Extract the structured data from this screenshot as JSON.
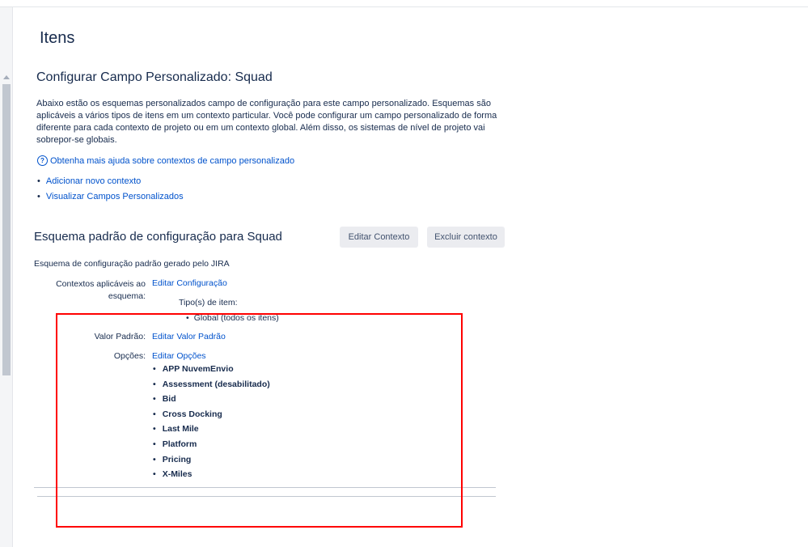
{
  "page": {
    "title": "Itens"
  },
  "config": {
    "title": "Configurar Campo Personalizado: Squad",
    "description": "Abaixo estão os esquemas personalizados campo de configuração para este campo personalizado. Esquemas são aplicáveis a vários tipos de itens em um contexto particular. Você pode configurar um campo personalizado de forma diferente para cada contexto de projeto ou em um contexto global. Além disso, os sistemas de nível de projeto vai sobrepor-se globais.",
    "help_icon": "question-circle-icon",
    "help_link": "Obtenha mais ajuda sobre contextos de campo personalizado",
    "links": [
      "Adicionar novo contexto",
      "Visualizar Campos Personalizados"
    ]
  },
  "scheme": {
    "title": "Esquema padrão de configuração para Squad",
    "edit_context_label": "Editar Contexto",
    "delete_context_label": "Excluir contexto",
    "description": "Esquema de configuração padrão gerado pelo JIRA",
    "contexts_label": "Contextos aplicáveis ao esquema:",
    "edit_configuration": "Editar Configuração",
    "issue_types_label": "Tipo(s) de item:",
    "issue_types": [
      "Global (todos os itens)"
    ],
    "default_value_label": "Valor Padrão:",
    "edit_default_value": "Editar Valor Padrão",
    "options_label": "Opções:",
    "edit_options": "Editar Opções",
    "options": [
      "APP NuvemEnvio",
      "Assessment (desabilitado)",
      "Bid",
      "Cross Docking",
      "Last Mile",
      "Platform",
      "Pricing",
      "X-Miles"
    ]
  },
  "colors": {
    "link": "#0052cc",
    "text": "#172b4d",
    "highlight": "#ff0000",
    "button_bg": "#ebecf0"
  }
}
